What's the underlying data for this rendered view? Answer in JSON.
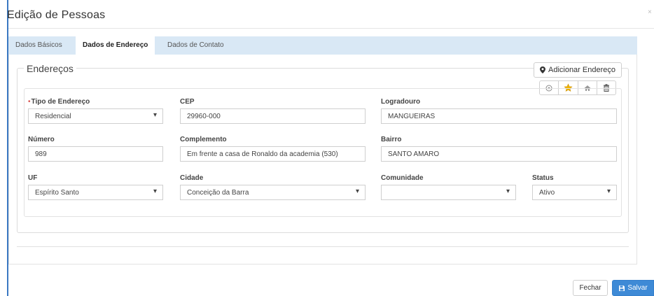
{
  "modal": {
    "title": "Edição de Pessoas",
    "close_glyph": "×"
  },
  "tabs": [
    {
      "label": "Dados Básicos",
      "active": false
    },
    {
      "label": "Dados de Endereço",
      "active": true
    },
    {
      "label": "Dados de Contato",
      "active": false
    }
  ],
  "address_section": {
    "legend": "Endereços",
    "add_button_label": "Adicionar Endereço",
    "add_button_icon": "map-marker-icon",
    "action_icons": [
      "target-icon",
      "star-icon",
      "home-icon",
      "trash-icon"
    ]
  },
  "form": {
    "tipo_endereco": {
      "label": "Tipo de Endereço",
      "required": true,
      "value": "Residencial"
    },
    "cep": {
      "label": "CEP",
      "value": "29960-000"
    },
    "logradouro": {
      "label": "Logradouro",
      "value": "MANGUEIRAS"
    },
    "numero": {
      "label": "Número",
      "value": "989"
    },
    "complemento": {
      "label": "Complemento",
      "value": "Em frente a casa de Ronaldo da academia (530)"
    },
    "bairro": {
      "label": "Bairro",
      "value": "SANTO AMARO"
    },
    "uf": {
      "label": "UF",
      "value": "Espírito Santo"
    },
    "cidade": {
      "label": "Cidade",
      "value": "Conceição da Barra"
    },
    "comunidade": {
      "label": "Comunidade",
      "value": ""
    },
    "status": {
      "label": "Status",
      "value": "Ativo"
    }
  },
  "footer": {
    "close_label": "Fechar",
    "save_label": "Salvar"
  },
  "colors": {
    "accent": "#3e8ad6",
    "tab_bar": "#d9e8f5",
    "modal_border": "#3a78c2",
    "star": "#f0b400"
  }
}
